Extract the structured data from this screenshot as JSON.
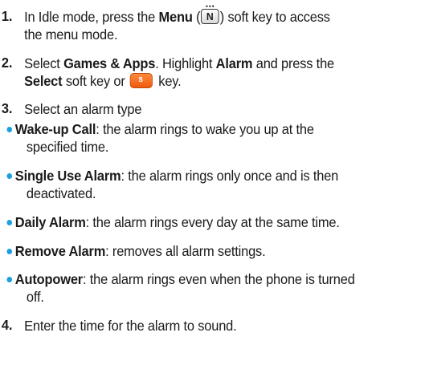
{
  "steps": {
    "s1": {
      "num": "1.",
      "pre": "In Idle mode, press the ",
      "bold": "Menu",
      "paren_open": " (",
      "key_glyph": "N",
      "key_dots": "•••",
      "post": ") soft key to access",
      "cont": "the menu mode."
    },
    "s2": {
      "num": "2.",
      "pre": "Select ",
      "bold1": "Games & Apps",
      "mid": ". Highlight ",
      "bold2": "Alarm",
      "post": " and press the",
      "bold3": "Select",
      "mid2": " soft key or ",
      "key_glyph": "s",
      "end": " key."
    },
    "s3": {
      "num": "3.",
      "text": "Select an alarm type"
    },
    "s4": {
      "num": "4.",
      "text": "Enter the time for the alarm to sound."
    }
  },
  "bullets": {
    "b1": {
      "term": "Wake-up Call",
      "desc": ": the alarm rings to wake you up at the",
      "cont": "specified time."
    },
    "b2": {
      "term": "Single Use Alarm",
      "desc": ": the alarm rings only once and is then",
      "cont": "deactivated."
    },
    "b3": {
      "term": "Daily Alarm",
      "desc": ": the alarm rings every day at the same time."
    },
    "b4": {
      "term": "Remove Alarm",
      "desc": ": removes all alarm settings."
    },
    "b5": {
      "term": "Autopower",
      "desc": ": the alarm rings even when the phone is turned",
      "cont": "off."
    }
  },
  "colors": {
    "bullet": "#1aa0e0",
    "select_key": "#ee5a10"
  }
}
